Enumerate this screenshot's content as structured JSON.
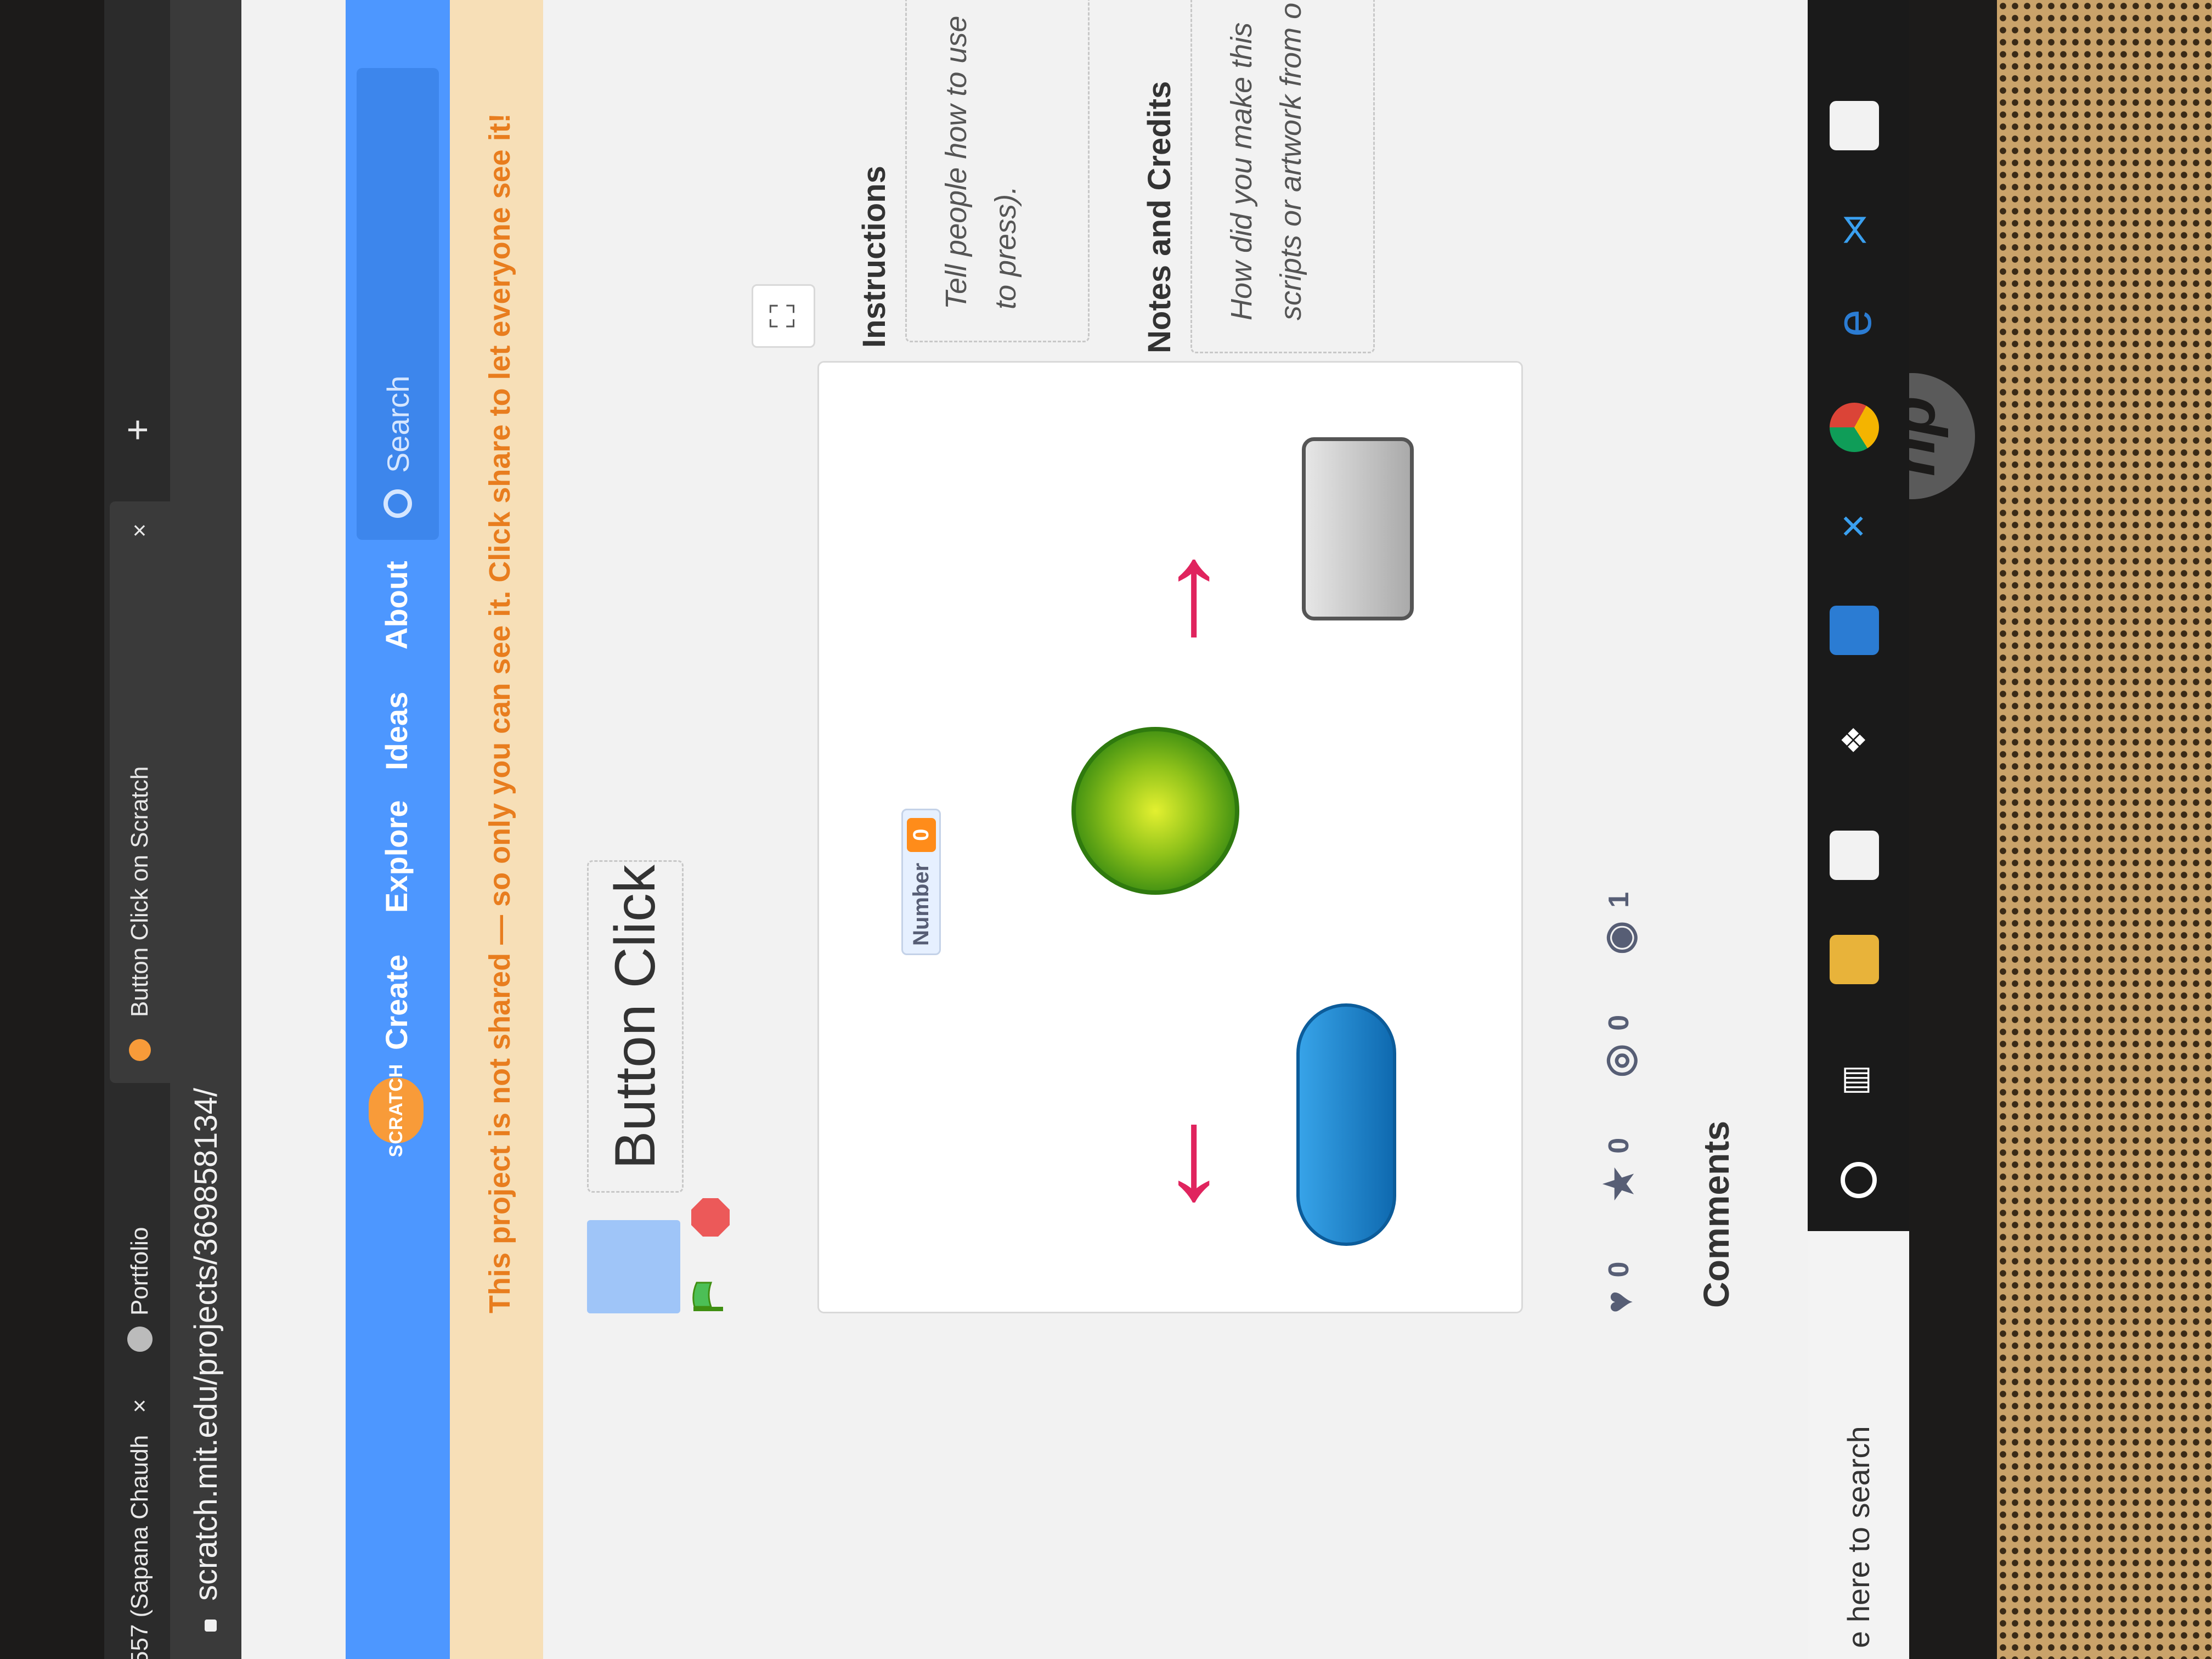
{
  "browser": {
    "tabs": [
      {
        "title": "557 (Sapana Chaudh",
        "close": "×"
      },
      {
        "title": "Portfolio"
      },
      {
        "title": "Button Click on Scratch",
        "close": "×"
      }
    ],
    "new_tab": "+",
    "url": "scratch.mit.edu/projects/369858134/"
  },
  "navbar": {
    "logo": "SCRATCH",
    "items": [
      "Create",
      "Explore",
      "Ideas",
      "About"
    ],
    "search_placeholder": "Search"
  },
  "banner": {
    "text": "This project is not shared — so only you can see it. Click share to let everyone see it!"
  },
  "project": {
    "title": "Button Click",
    "monitor_label": "Number",
    "monitor_value": "0",
    "arrow_left": "←",
    "arrow_right": "→"
  },
  "sidebar": {
    "instructions_title": "Instructions",
    "instructions_text_1": "Tell people how to use",
    "instructions_text_2": "to press).",
    "notes_title": "Notes and Credits",
    "notes_text_1": "How did you make this",
    "notes_text_2": "scripts or artwork from o"
  },
  "stats": {
    "loves": "0",
    "favorites": "0",
    "remixes": "0",
    "views": "1"
  },
  "comments": {
    "heading": "Comments"
  },
  "taskbar": {
    "search_text": "e here to search"
  },
  "device": {
    "brand": "hp"
  },
  "colors": {
    "scratch_blue": "#4d97ff",
    "banner_bg": "#f7dfb7",
    "banner_text": "#e87d1e",
    "arrow": "#e0245e",
    "monitor_value_bg": "#ff8c1a"
  }
}
